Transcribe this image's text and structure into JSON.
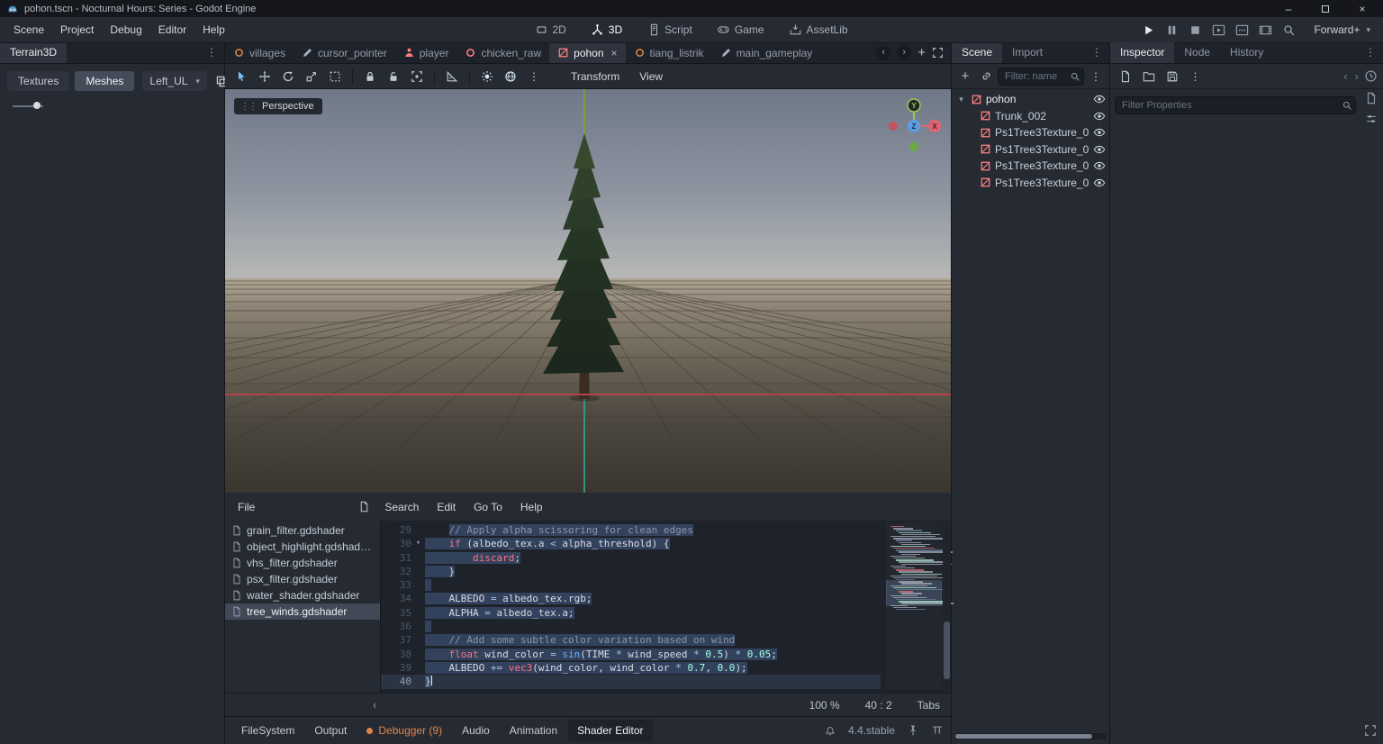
{
  "title_bar": {
    "title": "pohon.tscn - Nocturnal Hours: Series - Godot Engine"
  },
  "menus": [
    "Scene",
    "Project",
    "Debug",
    "Editor",
    "Help"
  ],
  "workspaces": [
    {
      "label": "2D",
      "icon": "flat"
    },
    {
      "label": "3D",
      "icon": "axes",
      "active": true
    },
    {
      "label": "Script",
      "icon": "script"
    },
    {
      "label": "Game",
      "icon": "game"
    },
    {
      "label": "AssetLib",
      "icon": "assetlib"
    }
  ],
  "playback": {
    "icons": [
      {
        "n": "play",
        "lit": true
      },
      {
        "n": "pause"
      },
      {
        "n": "stop"
      },
      {
        "n": "play-scene"
      },
      {
        "n": "play-custom"
      },
      {
        "n": "movie"
      },
      {
        "n": "mag"
      }
    ],
    "renderer": "Forward+"
  },
  "terrain_panel": {
    "title": "Terrain3D",
    "tools": [
      {
        "label": "Textures"
      },
      {
        "label": "Meshes",
        "active": true
      }
    ],
    "dropdown": "Left_UL"
  },
  "scene_tabs": [
    {
      "label": "villages",
      "icon": "ring",
      "color": "#d9823f"
    },
    {
      "label": "cursor_pointer",
      "icon": "pencil",
      "color": "#a7aeb9"
    },
    {
      "label": "player",
      "icon": "person",
      "color": "#fc7f7f"
    },
    {
      "label": "chicken_raw",
      "icon": "ring",
      "color": "#fc7f7f"
    },
    {
      "label": "pohon",
      "icon": "mesh",
      "color": "#fc7f7f",
      "active": true
    },
    {
      "label": "tiang_listrik",
      "icon": "ring",
      "color": "#d9823f"
    },
    {
      "label": "main_gameplay",
      "icon": "pencil",
      "color": "#a7aeb9"
    }
  ],
  "viewport": {
    "toolbar": [
      {
        "n": "cursor",
        "on": true
      },
      {
        "n": "move"
      },
      {
        "n": "rotate"
      },
      {
        "n": "scale"
      },
      {
        "n": "box-select"
      },
      "|",
      {
        "n": "lock"
      },
      {
        "n": "unlock"
      },
      {
        "n": "group"
      },
      "|",
      {
        "n": "ruler"
      },
      "|",
      {
        "n": "sun",
        "lit": true
      },
      {
        "n": "globe",
        "lit": true
      },
      {
        "n": "dots"
      }
    ],
    "menus": [
      "Transform",
      "View"
    ],
    "perspective": "Perspective",
    "axis_labels": {
      "x": "X",
      "y": "Y",
      "z": "Z"
    }
  },
  "shader": {
    "menu": [
      "File",
      "Search",
      "Edit",
      "Go To",
      "Help"
    ],
    "files": [
      "grain_filter.gdshader",
      "object_highlight.gdshad…",
      "vhs_filter.gdshader",
      "psx_filter.gdshader",
      "water_shader.gdshader",
      "tree_winds.gdshader"
    ],
    "selected_file": "tree_winds.gdshader",
    "status": {
      "zoom": "100 %",
      "cursor": "40 :   2",
      "tabs": "Tabs"
    },
    "code": [
      {
        "n": 29,
        "seg": [
          [
            "    ",
            "d",
            0
          ],
          [
            "// Apply alpha scissoring for clean edges",
            "com",
            1
          ]
        ]
      },
      {
        "n": 30,
        "fold": true,
        "seg": [
          [
            "    ",
            "d",
            1
          ],
          [
            "if",
            "kw",
            1
          ],
          [
            " (albedo_tex.a ",
            "d",
            1
          ],
          [
            "<",
            "sym",
            1
          ],
          [
            " alpha_threshold) {",
            "d",
            1
          ]
        ]
      },
      {
        "n": 31,
        "seg": [
          [
            "        ",
            "d",
            1
          ],
          [
            "discard",
            "kw",
            1
          ],
          [
            ";",
            "d",
            1
          ]
        ]
      },
      {
        "n": 32,
        "seg": [
          [
            "    }",
            "d",
            1
          ]
        ]
      },
      {
        "n": 33,
        "seg": [
          [
            " ",
            "d",
            1
          ]
        ]
      },
      {
        "n": 34,
        "seg": [
          [
            "    ALBEDO ",
            "d",
            1
          ],
          [
            "=",
            "sym",
            1
          ],
          [
            " albedo_tex.rgb;",
            "d",
            1
          ]
        ]
      },
      {
        "n": 35,
        "seg": [
          [
            "    ALPHA ",
            "d",
            1
          ],
          [
            "=",
            "sym",
            1
          ],
          [
            " albedo_tex.a;",
            "d",
            1
          ]
        ]
      },
      {
        "n": 36,
        "seg": [
          [
            " ",
            "d",
            1
          ]
        ]
      },
      {
        "n": 37,
        "seg": [
          [
            "    ",
            "d",
            1
          ],
          [
            "// Add some subtle color variation based on wind",
            "com",
            1
          ]
        ]
      },
      {
        "n": 38,
        "seg": [
          [
            "    ",
            "d",
            1
          ],
          [
            "float",
            "kw",
            1
          ],
          [
            " wind_color ",
            "d",
            1
          ],
          [
            "=",
            "sym",
            1
          ],
          [
            " ",
            "d",
            1
          ],
          [
            "sin",
            "fn",
            1
          ],
          [
            "(TIME ",
            "d",
            1
          ],
          [
            "*",
            "sym",
            1
          ],
          [
            " wind_speed ",
            "d",
            1
          ],
          [
            "*",
            "sym",
            1
          ],
          [
            " ",
            "d",
            1
          ],
          [
            "0.5",
            "num",
            1
          ],
          [
            ") ",
            "d",
            1
          ],
          [
            "*",
            "sym",
            1
          ],
          [
            " ",
            "d",
            1
          ],
          [
            "0.05",
            "num",
            1
          ],
          [
            ";",
            "d",
            1
          ]
        ]
      },
      {
        "n": 39,
        "seg": [
          [
            "    ",
            "d",
            1
          ],
          [
            "ALBEDO ",
            "d",
            1
          ],
          [
            "+=",
            "sym",
            1
          ],
          [
            " ",
            "d",
            1
          ],
          [
            "vec3",
            "kw",
            1
          ],
          [
            "(wind_color, wind_color ",
            "d",
            1
          ],
          [
            "*",
            "sym",
            1
          ],
          [
            " ",
            "d",
            1
          ],
          [
            "0.7",
            "num",
            1
          ],
          [
            ", ",
            "d",
            1
          ],
          [
            "0.0",
            "num",
            1
          ],
          [
            ");",
            "d",
            1
          ]
        ]
      },
      {
        "n": 40,
        "cur": true,
        "seg": [
          [
            "}",
            "d",
            1
          ]
        ]
      }
    ]
  },
  "bottom_bar": {
    "items": [
      {
        "label": "FileSystem"
      },
      {
        "label": "Output"
      },
      {
        "label": "Debugger (9)",
        "alert": true
      },
      {
        "label": "Audio"
      },
      {
        "label": "Animation"
      },
      {
        "label": "Shader Editor",
        "active": true
      }
    ],
    "version": "4.4.stable"
  },
  "scene_dock": {
    "tabs": [
      {
        "label": "Scene",
        "active": true
      },
      {
        "label": "Import"
      }
    ],
    "filter_placeholder": "Filter: name",
    "nodes": [
      {
        "label": "pohon",
        "depth": 0,
        "root": true
      },
      {
        "label": "Trunk_002",
        "depth": 1
      },
      {
        "label": "Ps1Tree3Texture_0",
        "depth": 1
      },
      {
        "label": "Ps1Tree3Texture_0",
        "depth": 1
      },
      {
        "label": "Ps1Tree3Texture_0",
        "depth": 1
      },
      {
        "label": "Ps1Tree3Texture_0",
        "depth": 1
      }
    ]
  },
  "inspector_dock": {
    "tabs": [
      {
        "label": "Inspector",
        "active": true
      },
      {
        "label": "Node"
      },
      {
        "label": "History"
      }
    ],
    "filter_placeholder": "Filter Properties"
  }
}
